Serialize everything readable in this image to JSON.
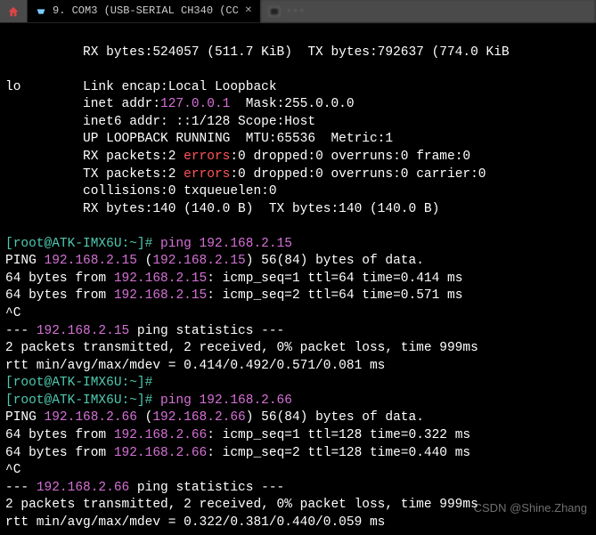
{
  "tabs": {
    "home_icon": "home",
    "active_tab_label": "9. COM3  (USB-SERIAL CH340 (CC",
    "blur_tab_label": "···"
  },
  "term": {
    "l01a": "          RX bytes:524057 (511.7 KiB)  TX bytes:792637 (774.0 KiB",
    "l02": "",
    "l03a": "lo        Link encap:Local Loopback",
    "l04a": "          inet addr:",
    "l04b": "127.0.0.1",
    "l04c": "  Mask:255.0.0.0",
    "l05a": "          inet6 addr: ::1/128 Scope:Host",
    "l06a": "          UP LOOPBACK RUNNING  MTU:65536  Metric:1",
    "l07a": "          RX packets:2 ",
    "l07b": "errors",
    "l07c": ":0 dropped:0 overruns:0 frame:0",
    "l08a": "          TX packets:2 ",
    "l08b": "errors",
    "l08c": ":0 dropped:0 overruns:0 carrier:0",
    "l09a": "          collisions:0 txqueuelen:0",
    "l10a": "          RX bytes:140 (140.0 B)  TX bytes:140 (140.0 B)",
    "l11": "",
    "l12a": "[root@ATK-IMX6U:~]# ",
    "l12b": "ping 192.168.2.15",
    "l13a": "PING ",
    "l13b": "192.168.2.15",
    "l13c": " (",
    "l13d": "192.168.2.15",
    "l13e": ") 56(84) bytes of data.",
    "l14a": "64 bytes from ",
    "l14b": "192.168.2.15",
    "l14c": ": icmp_seq=1 ttl=64 time=0.414 ms",
    "l15a": "64 bytes from ",
    "l15b": "192.168.2.15",
    "l15c": ": icmp_seq=2 ttl=64 time=0.571 ms",
    "l16a": "^C",
    "l17a": "--- ",
    "l17b": "192.168.2.15",
    "l17c": " ping statistics ---",
    "l18a": "2 packets transmitted, 2 received, 0% packet loss, time 999ms",
    "l19a": "rtt min/avg/max/mdev = 0.414/0.492/0.571/0.081 ms",
    "l20a": "[root@ATK-IMX6U:~]# ",
    "l21a": "[root@ATK-IMX6U:~]# ",
    "l21b": "ping 192.168.2.66",
    "l22a": "PING ",
    "l22b": "192.168.2.66",
    "l22c": " (",
    "l22d": "192.168.2.66",
    "l22e": ") 56(84) bytes of data.",
    "l23a": "64 bytes from ",
    "l23b": "192.168.2.66",
    "l23c": ": icmp_seq=1 ttl=128 time=0.322 ms",
    "l24a": "64 bytes from ",
    "l24b": "192.168.2.66",
    "l24c": ": icmp_seq=2 ttl=128 time=0.440 ms",
    "l25a": "^C",
    "l26a": "--- ",
    "l26b": "192.168.2.66",
    "l26c": " ping statistics ---",
    "l27a": "2 packets transmitted, 2 received, 0% packet loss, time 999ms",
    "l28a": "rtt min/avg/max/mdev = 0.322/0.381/0.440/0.059 ms"
  },
  "watermark": "CSDN @Shine.Zhang"
}
